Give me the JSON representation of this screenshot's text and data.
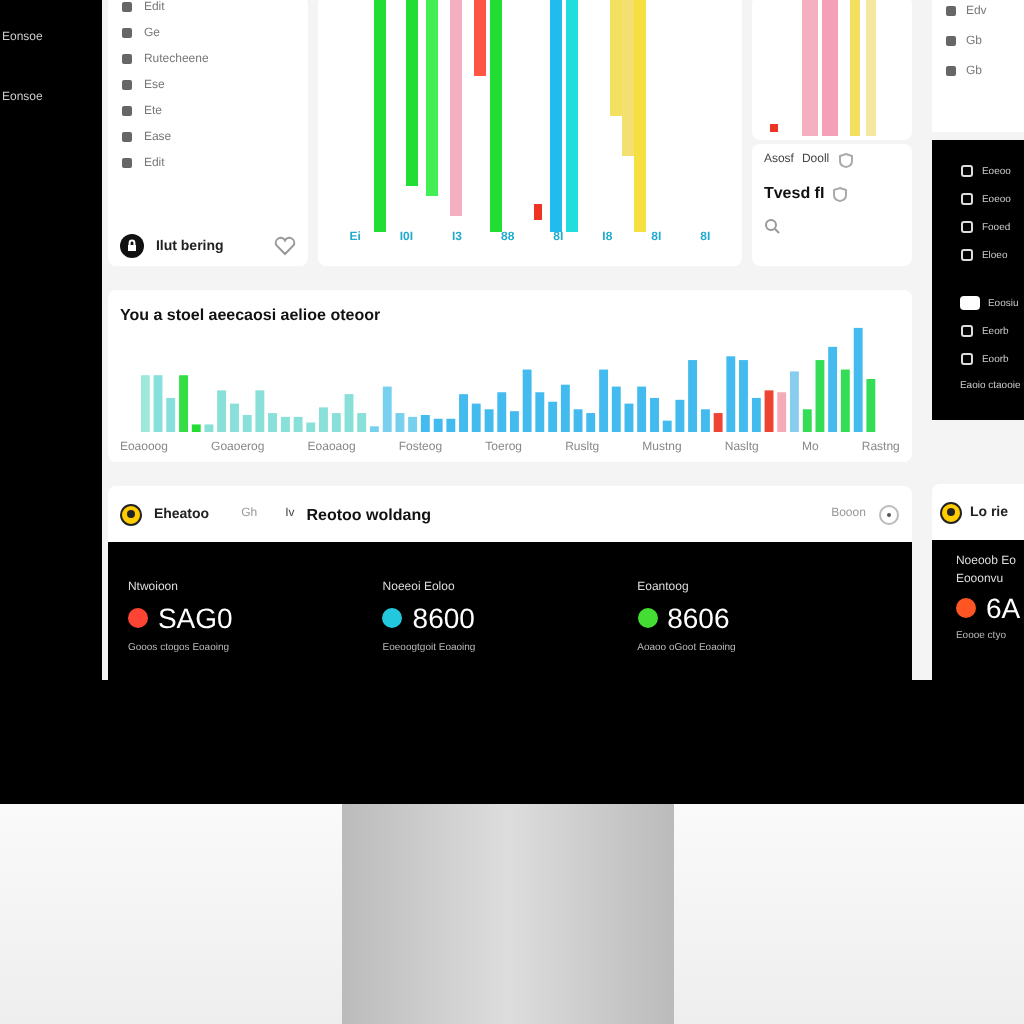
{
  "sidebar": {
    "items": [
      {
        "label": "Eonsoe"
      },
      {
        "label": "Eonsoe"
      }
    ]
  },
  "list_card": {
    "items": [
      {
        "label": "Edit"
      },
      {
        "label": "Ge"
      },
      {
        "label": "Rutecheene"
      },
      {
        "label": "Ese"
      },
      {
        "label": "Ete"
      },
      {
        "label": "Ease"
      },
      {
        "label": "Edit"
      }
    ],
    "footer": "Ilut bering"
  },
  "tall_chart": {
    "labels": [
      "Ei",
      "I0I",
      "I3",
      "88",
      "8I",
      "I8",
      "8I",
      "8I"
    ]
  },
  "small_card": {
    "rows": [
      {
        "label": "Asosf",
        "value": "Dooll"
      },
      {
        "label": "Tvesd fI"
      }
    ]
  },
  "wide_chart": {
    "title": "You a  stoel aeecaosi aelioe oteoor",
    "labels": [
      "Eoaooog",
      "Goaoerog",
      "Eoaoaog",
      "Fosteog",
      "Toerog",
      "Rusltg",
      "Mustng",
      "Nasltg",
      "Mo",
      "Rastng"
    ]
  },
  "panel": {
    "title": "Eheatoo",
    "tab": "Gh",
    "toggle": "Iv",
    "heading": "Reotoo woldang",
    "action": "Booon",
    "stats": [
      {
        "label": "Ntwoioon",
        "value": "SAG0",
        "note": "Gooos ctogos Eoaoing",
        "color": "#ff4433"
      },
      {
        "label": "Noeeoi Eoloo",
        "value": "8600",
        "note": "Eoeoogtgoit Eoaoing",
        "color": "#22c8dd"
      },
      {
        "label": "Eoantoog",
        "value": "8606",
        "note": "Aoaoo oGoot Eoaoing",
        "color": "#44dd33"
      }
    ]
  },
  "right_column": {
    "top_items": [
      {
        "label": "Edv"
      },
      {
        "label": "Gb"
      },
      {
        "label": "Gb"
      }
    ],
    "dark_items": [
      {
        "label": "Eoeoo"
      },
      {
        "label": "Eoeoo"
      },
      {
        "label": "Fooed"
      },
      {
        "label": "Eloeo"
      },
      {
        "label": "Eoosiu"
      },
      {
        "label": "Eeorb"
      },
      {
        "label": "Eoorb"
      }
    ],
    "dark_footer": "Eaoio ctaooie",
    "card": {
      "title": "Lo rie",
      "label": "Noeoob Eo",
      "sub": "Eooonvu",
      "value": "6A",
      "note": "Eoooe ctyo",
      "color": "#ff5522"
    }
  }
}
